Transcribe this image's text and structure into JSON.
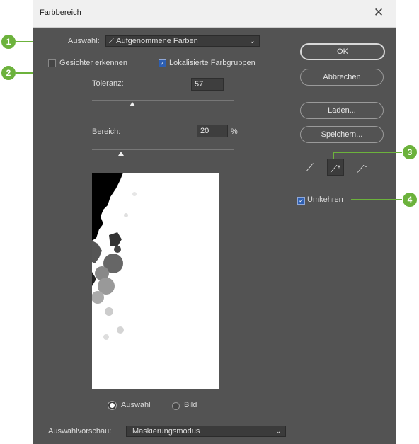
{
  "window": {
    "title": "Farbbereich",
    "close_glyph": "✕"
  },
  "auswahl": {
    "label": "Auswahl:",
    "value": "Aufgenommene Farben",
    "icon": "eyedropper-icon"
  },
  "options": {
    "faces_label": "Gesichter erkennen",
    "faces_checked": false,
    "localized_label": "Lokalisierte Farbgruppen",
    "localized_checked": true
  },
  "tolerance": {
    "label": "Toleranz:",
    "value": "57",
    "fraction": 0.28
  },
  "range": {
    "label": "Bereich:",
    "value": "20",
    "unit": "%",
    "fraction": 0.2
  },
  "preview_mode": {
    "auswahl_label": "Auswahl",
    "bild_label": "Bild",
    "selected": "auswahl"
  },
  "buttons": {
    "ok": "OK",
    "cancel": "Abbrechen",
    "load": "Laden...",
    "save": "Speichern..."
  },
  "pickers": [
    {
      "icon": "eyedropper-icon"
    },
    {
      "icon": "eyedropper-plus-icon"
    },
    {
      "icon": "eyedropper-minus-icon"
    }
  ],
  "invert": {
    "label": "Umkehren",
    "checked": true
  },
  "preview_select": {
    "label": "Auswahlvorschau:",
    "value": "Maskierungsmodus"
  },
  "callouts": [
    "1",
    "2",
    "3",
    "4"
  ],
  "colors": {
    "dialog_bg": "#535353",
    "callout": "#6cb23c",
    "accent_check": "#2d5fb2"
  }
}
